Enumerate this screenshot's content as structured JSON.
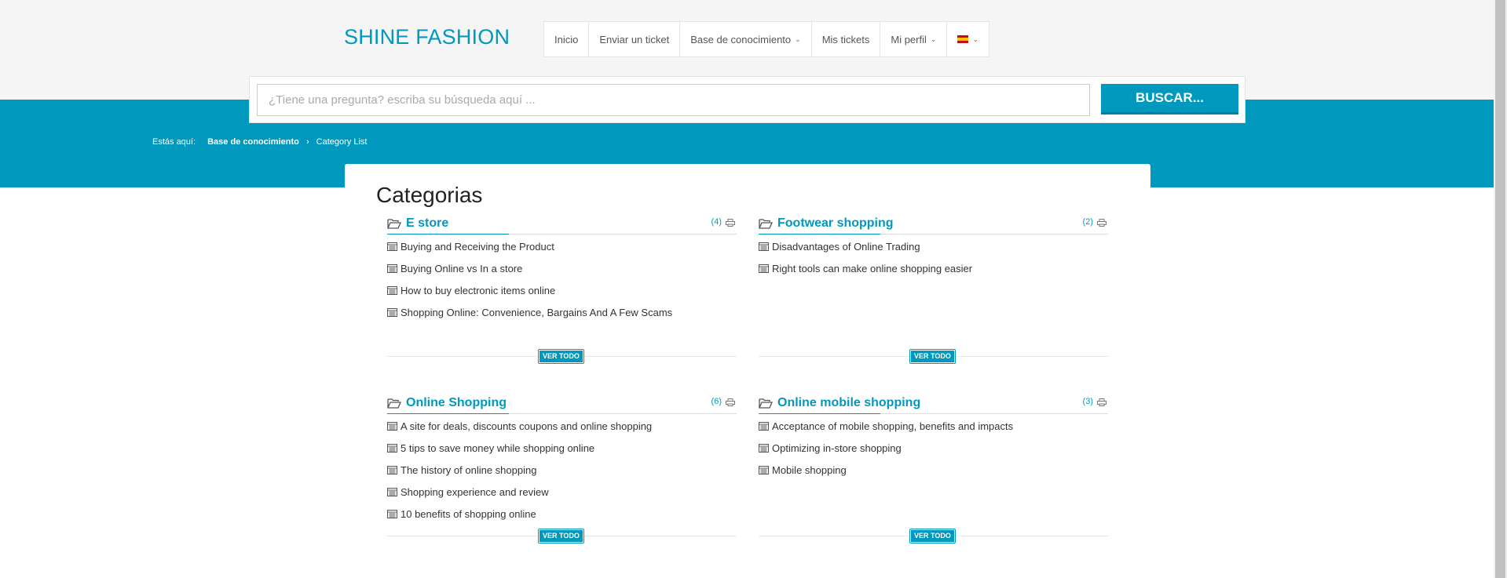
{
  "header": {
    "logo": "SHINE FASHION",
    "nav": [
      {
        "label": "Inicio"
      },
      {
        "label": "Enviar un ticket"
      },
      {
        "label": "Base de conocimiento"
      },
      {
        "label": "Mis tickets"
      },
      {
        "label": "Mi perfil"
      }
    ],
    "language_icon": "spain-flag-icon"
  },
  "search": {
    "placeholder": "¿Tiene una pregunta? escriba su búsqueda aquí ...",
    "value": "",
    "button_label": "BUSCAR..."
  },
  "breadcrumb": {
    "label": "Estás aquí:",
    "link": "Base de conocimiento",
    "current": "Category List"
  },
  "main": {
    "title": "Categorias",
    "view_all_label": "VER TODO",
    "categories": [
      {
        "title": "E store",
        "count": "(4)",
        "articles": [
          "Buying and Receiving the Product",
          "Buying Online vs In a store",
          "How to buy electronic items online",
          "Shopping Online: Convenience, Bargains And A Few Scams"
        ]
      },
      {
        "title": "Footwear shopping",
        "count": "(2)",
        "articles": [
          "Disadvantages of Online Trading",
          "Right tools can make online shopping easier"
        ]
      },
      {
        "title": "Online Shopping",
        "count": "(6)",
        "articles": [
          "A site for deals, discounts coupons and online shopping",
          "5 tips to save money while shopping online",
          "The history of online shopping",
          "Shopping experience and review",
          "10 benefits of shopping online"
        ]
      },
      {
        "title": "Online mobile shopping",
        "count": "(3)",
        "articles": [
          "Acceptance of mobile shopping, benefits and impacts",
          "Optimizing in-store shopping",
          "Mobile shopping"
        ]
      }
    ]
  },
  "colors": {
    "accent": "#0099bd",
    "header_bg": "#f5f5f5",
    "text": "#333333"
  }
}
